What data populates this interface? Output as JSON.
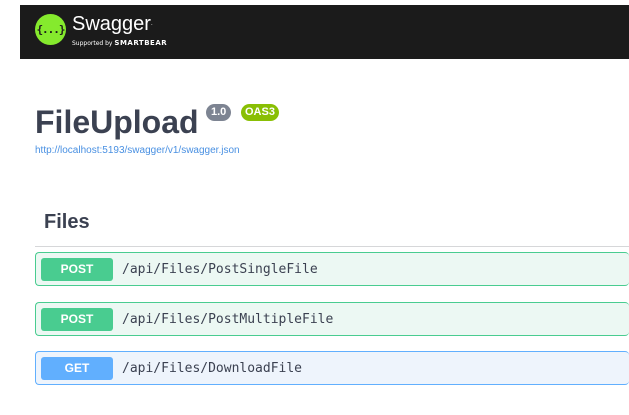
{
  "header": {
    "brand": "Swagger",
    "tagline_prefix": "Supported by",
    "tagline_company": "SMARTBEAR",
    "logo_glyph": "{...}"
  },
  "info": {
    "title": "FileUpload",
    "version": "1.0",
    "oas": "OAS3",
    "spec_url": "http://localhost:5193/swagger/v1/swagger.json"
  },
  "section": {
    "title": "Files",
    "operations": [
      {
        "method": "POST",
        "path": "/api/Files/PostSingleFile"
      },
      {
        "method": "POST",
        "path": "/api/Files/PostMultipleFile"
      },
      {
        "method": "GET",
        "path": "/api/Files/DownloadFile"
      }
    ]
  },
  "colors": {
    "topbar": "#1b1b1b",
    "logo": "#85ea2d",
    "post": "#49cc90",
    "get": "#61affe",
    "oas": "#89bf04",
    "version": "#7d8492"
  }
}
